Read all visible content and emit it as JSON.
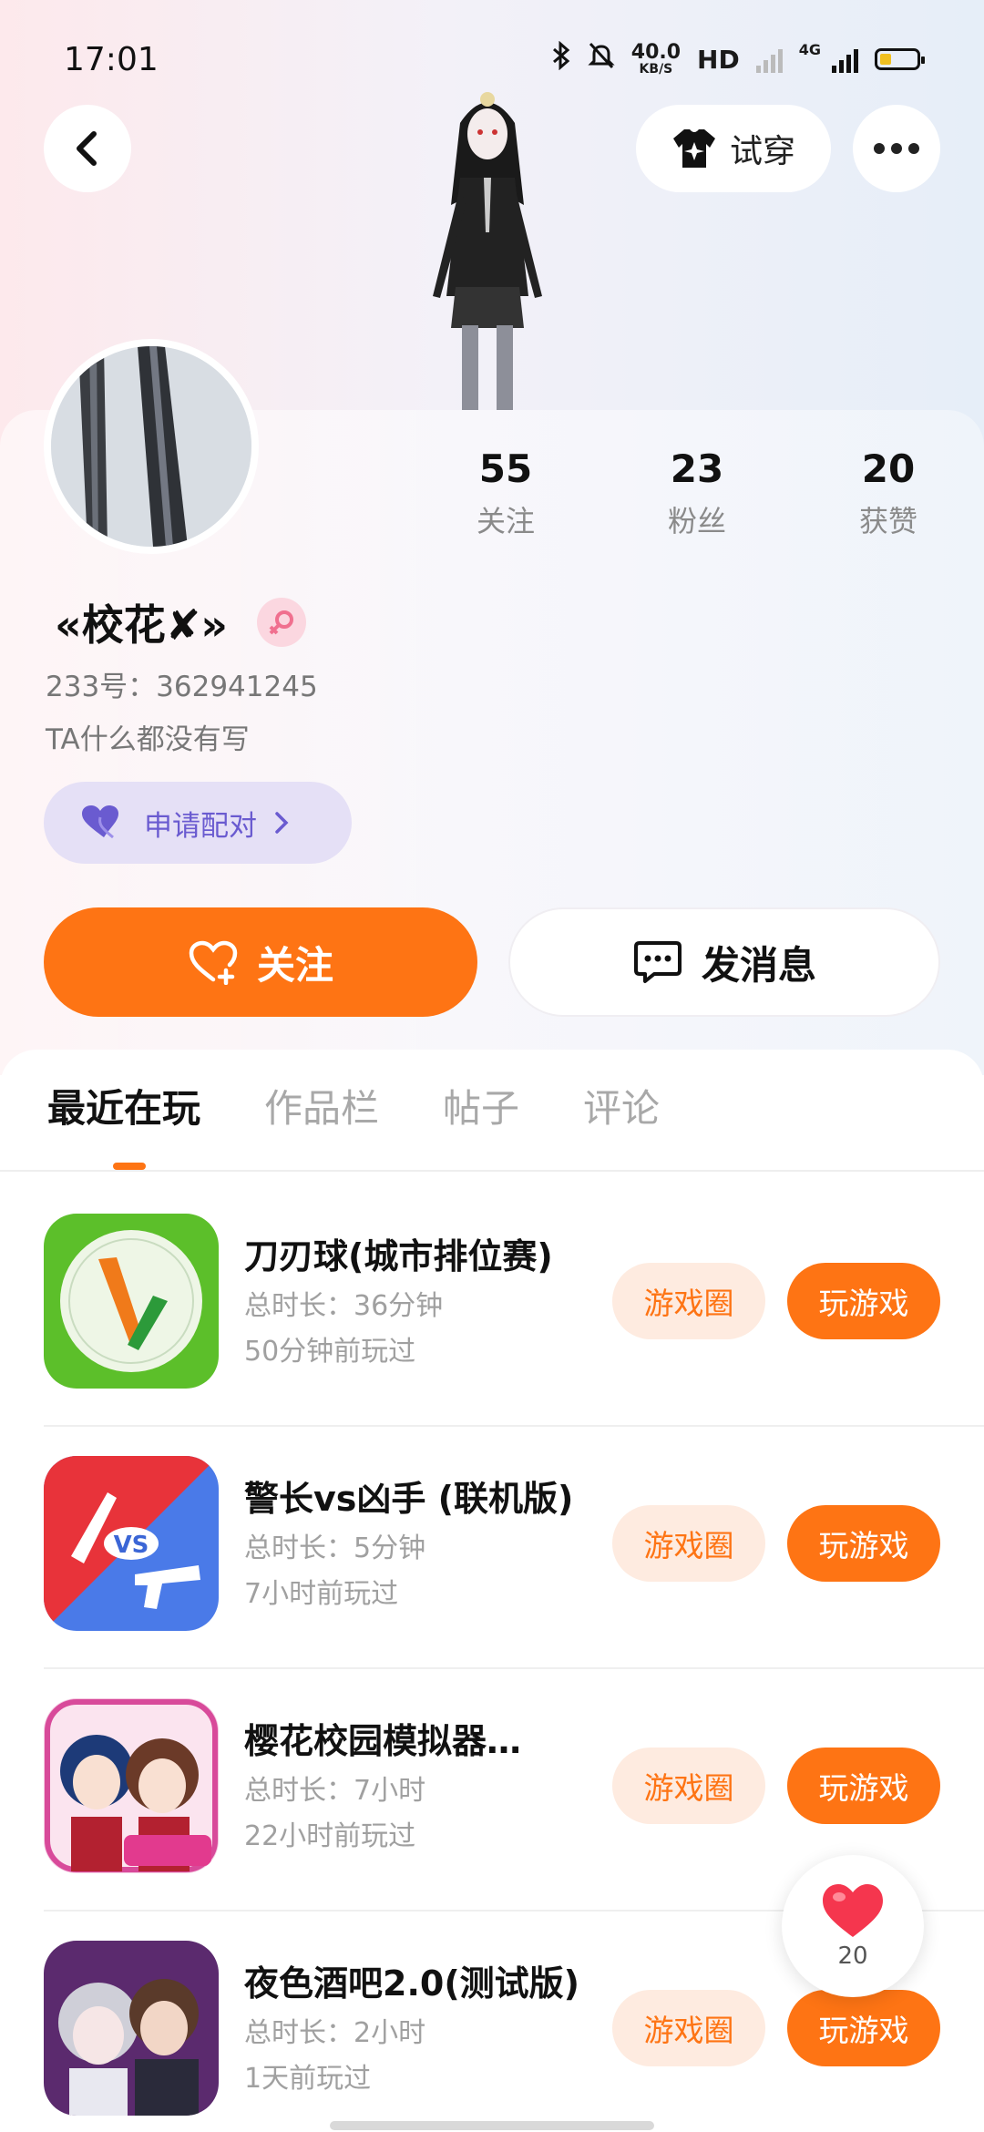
{
  "status_bar": {
    "time": "17:01",
    "net_speed_value": "40.0",
    "net_speed_unit": "KB/S",
    "hd_label": "HD",
    "network_type": "4G"
  },
  "header": {
    "try_on_label": "试穿"
  },
  "profile": {
    "stats": [
      {
        "value": "55",
        "label": "关注"
      },
      {
        "value": "23",
        "label": "粉丝"
      },
      {
        "value": "20",
        "label": "获赞"
      }
    ],
    "username": "«校花✘»",
    "uid": "233号：362941245",
    "bio": "TA什么都没有写",
    "pair_label": "申请配对",
    "follow_label": "关注",
    "message_label": "发消息"
  },
  "tabs": [
    {
      "label": "最近在玩",
      "active": true
    },
    {
      "label": "作品栏",
      "active": false
    },
    {
      "label": "帖子",
      "active": false
    },
    {
      "label": "评论",
      "active": false
    }
  ],
  "games": [
    {
      "title": "刀刃球(城市排位赛)",
      "duration": "总时长：36分钟",
      "last_played": "50分钟前玩过",
      "circle_label": "游戏圈",
      "play_label": "玩游戏",
      "icon": "knife-ball-icon"
    },
    {
      "title": "警长vs凶手 (联机版)",
      "duration": "总时长：5分钟",
      "last_played": "7小时前玩过",
      "circle_label": "游戏圈",
      "play_label": "玩游戏",
      "icon": "sheriff-vs-murderer-icon"
    },
    {
      "title": "樱花校园模拟器…",
      "duration": "总时长：7小时",
      "last_played": "22小时前玩过",
      "circle_label": "游戏圈",
      "play_label": "玩游戏",
      "icon": "sakura-school-icon"
    },
    {
      "title": "夜色酒吧2.0(测试版)",
      "duration": "总时长：2小时",
      "last_played": "1天前玩过",
      "circle_label": "游戏圈",
      "play_label": "玩游戏",
      "icon": "night-bar-icon"
    }
  ],
  "like_float": {
    "count": "20"
  },
  "colors": {
    "accent": "#fe7414",
    "pair_bg": "#e5e0f6",
    "pair_text": "#6a5bd0"
  }
}
